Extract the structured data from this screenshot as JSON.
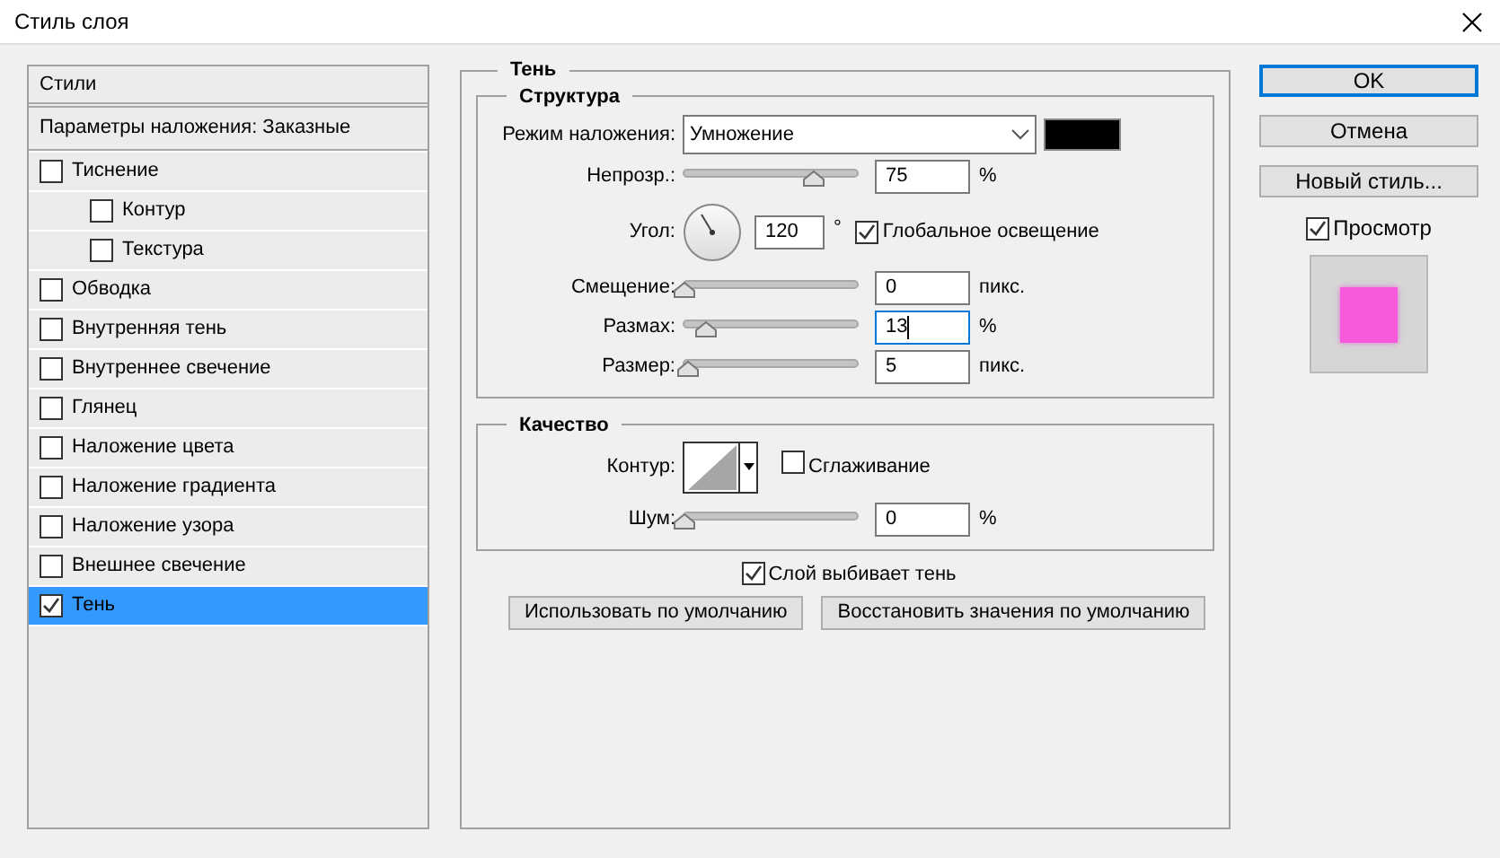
{
  "window": {
    "title": "Стиль слоя"
  },
  "styles_list": {
    "header": "Стили",
    "blending": "Параметры наложения: Заказные",
    "items": [
      {
        "label": "Тиснение",
        "checked": false,
        "selected": false,
        "children": [
          {
            "label": "Контур",
            "checked": false,
            "selected": false
          },
          {
            "label": "Текстура",
            "checked": false,
            "selected": false
          }
        ]
      },
      {
        "label": "Обводка",
        "checked": false,
        "selected": false
      },
      {
        "label": "Внутренняя тень",
        "checked": false,
        "selected": false
      },
      {
        "label": "Внутреннее свечение",
        "checked": false,
        "selected": false
      },
      {
        "label": "Глянец",
        "checked": false,
        "selected": false
      },
      {
        "label": "Наложение цвета",
        "checked": false,
        "selected": false
      },
      {
        "label": "Наложение градиента",
        "checked": false,
        "selected": false
      },
      {
        "label": "Наложение узора",
        "checked": false,
        "selected": false
      },
      {
        "label": "Внешнее свечение",
        "checked": false,
        "selected": false
      },
      {
        "label": "Тень",
        "checked": true,
        "selected": true
      }
    ]
  },
  "shadow_panel": {
    "title": "Тень",
    "structure": {
      "title": "Структура",
      "blend_mode": {
        "label": "Режим наложения:",
        "value": "Умножение",
        "color": "#000000"
      },
      "rows": [
        {
          "kind": "slider",
          "label": "Непрозр.:",
          "value": "75",
          "unit": "%",
          "level": 0.75,
          "focused": false
        },
        {
          "kind": "angle",
          "label": "Угол:",
          "value": "120",
          "unit": "°",
          "global_light": {
            "label": "Глобальное освещение",
            "checked": true
          }
        },
        {
          "kind": "slider",
          "label": "Смещение:",
          "value": "0",
          "unit": "пикс.",
          "level": 0,
          "focused": false
        },
        {
          "kind": "slider",
          "label": "Размах:",
          "value": "13",
          "unit": "%",
          "level": 0.13,
          "focused": true
        },
        {
          "kind": "slider",
          "label": "Размер:",
          "value": "5",
          "unit": "пикс.",
          "level": 0.02,
          "focused": false
        }
      ]
    },
    "quality": {
      "title": "Качество",
      "contour_label": "Контур:",
      "antialias": {
        "label": "Сглаживание",
        "checked": false
      },
      "noise": {
        "label": "Шум:",
        "value": "0",
        "unit": "%",
        "level": 0
      }
    },
    "knockout": {
      "label": "Слой выбивает тень",
      "checked": true
    },
    "buttons": [
      "Использовать по умолчанию",
      "Восстановить значения по умолчанию"
    ]
  },
  "side_buttons": [
    {
      "label": "OK",
      "default": true
    },
    {
      "label": "Отмена",
      "default": false
    },
    {
      "label": "Новый стиль...",
      "default": false
    }
  ],
  "preview": {
    "label": "Просмотр",
    "checked": true
  }
}
